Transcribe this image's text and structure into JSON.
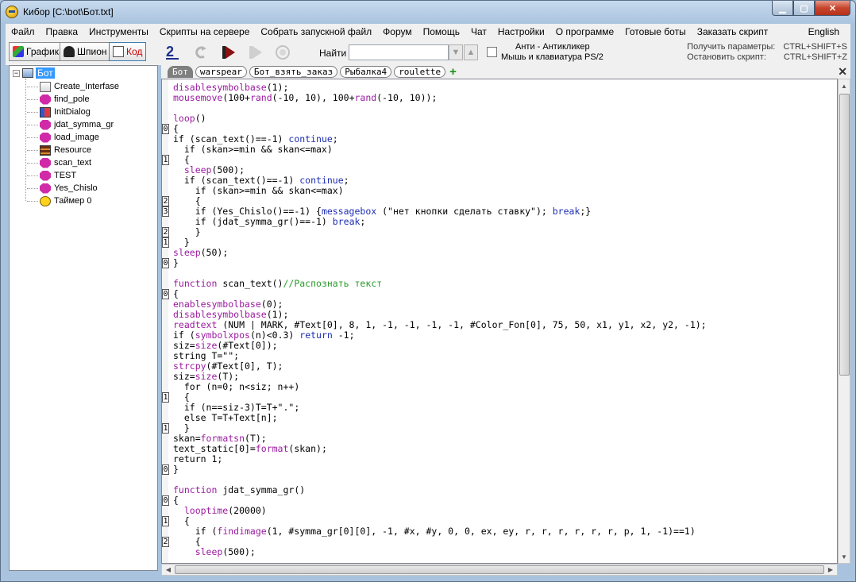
{
  "window": {
    "title": "Кибор  [C:\\bot\\Бот.txt]",
    "controls": {
      "minimize": "▁",
      "maximize": "▢",
      "close": "✕"
    }
  },
  "menu": [
    "Файл",
    "Правка",
    "Инструменты",
    "Скрипты на сервере",
    "Собрать запускной файл",
    "Форум",
    "Помощь",
    "Чат",
    "Настройки",
    "О программе",
    "Готовые боты",
    "Заказать скрипт"
  ],
  "menu_right": "English",
  "toolbar": {
    "mode_buttons": [
      "Графика",
      "Шпион",
      "Код"
    ],
    "find_label": "Найти",
    "find_value": "",
    "anti_line1": "Анти - Антикликер",
    "anti_line2": "Мышь и клавиатура PS/2",
    "hint1_label": "Получить параметры:",
    "hint1_keys": "CTRL+SHIFT+S",
    "hint2_label": "Остановить скрипт:",
    "hint2_keys": "CTRL+SHIFT+Z"
  },
  "tree": {
    "root": "Бот",
    "items": [
      {
        "label": "Create_Interfase",
        "icon": "document-icon"
      },
      {
        "label": "find_pole",
        "icon": "function-icon"
      },
      {
        "label": "InitDialog",
        "icon": "dialog-icon"
      },
      {
        "label": "jdat_symma_gr",
        "icon": "function-icon"
      },
      {
        "label": "load_image",
        "icon": "function-icon"
      },
      {
        "label": "Resource",
        "icon": "resource-icon"
      },
      {
        "label": "scan_text",
        "icon": "function-icon"
      },
      {
        "label": "TEST",
        "icon": "function-icon"
      },
      {
        "label": "Yes_Chislo",
        "icon": "function-icon"
      },
      {
        "label": "Таймер 0",
        "icon": "timer-icon"
      }
    ]
  },
  "tabs": [
    "Бот",
    "warspear",
    "Бот_взять_заказ",
    "Рыбалка4",
    "roulette"
  ],
  "tab_add": "+",
  "tab_close": "✕",
  "code_lines": [
    {
      "m": "",
      "seg": [
        [
          "f",
          "disablesymbolbase"
        ],
        [
          "d",
          "(1);"
        ]
      ]
    },
    {
      "m": "",
      "seg": [
        [
          "f",
          "mousemove"
        ],
        [
          "d",
          "(100+"
        ],
        [
          "f",
          "rand"
        ],
        [
          "d",
          "(-10, 10), 100+"
        ],
        [
          "f",
          "rand"
        ],
        [
          "d",
          "(-10, 10));"
        ]
      ]
    },
    {
      "m": "",
      "seg": [
        [
          "d",
          ""
        ]
      ]
    },
    {
      "m": "",
      "seg": [
        [
          "f",
          "loop"
        ],
        [
          "d",
          "()"
        ]
      ]
    },
    {
      "m": "0",
      "seg": [
        [
          "d",
          "{"
        ]
      ]
    },
    {
      "m": "",
      "seg": [
        [
          "d",
          "if (scan_text()==-1) "
        ],
        [
          "k",
          "continue"
        ],
        [
          "d",
          ";"
        ]
      ]
    },
    {
      "m": "",
      "seg": [
        [
          "d",
          "  if (skan>=min && skan<=max)"
        ]
      ]
    },
    {
      "m": "1",
      "seg": [
        [
          "d",
          "  {"
        ]
      ]
    },
    {
      "m": "",
      "seg": [
        [
          "f",
          "  sleep"
        ],
        [
          "d",
          "(500);"
        ]
      ]
    },
    {
      "m": "",
      "seg": [
        [
          "d",
          "  if (scan_text()==-1) "
        ],
        [
          "k",
          "continue"
        ],
        [
          "d",
          ";"
        ]
      ]
    },
    {
      "m": "",
      "seg": [
        [
          "d",
          "    if (skan>=min && skan<=max)"
        ]
      ]
    },
    {
      "m": "2",
      "seg": [
        [
          "d",
          "    {"
        ]
      ]
    },
    {
      "m": "3",
      "seg": [
        [
          "d",
          "    if (Yes_Chislo()==-1) {"
        ],
        [
          "k",
          "messagebox"
        ],
        [
          "d",
          " (\"нет кнопки сделать ставку\"); "
        ],
        [
          "k",
          "break"
        ],
        [
          "d",
          ";}"
        ]
      ]
    },
    {
      "m": "",
      "seg": [
        [
          "d",
          "    if (jdat_symma_gr()==-1) "
        ],
        [
          "k",
          "break"
        ],
        [
          "d",
          ";"
        ]
      ]
    },
    {
      "m": "2",
      "seg": [
        [
          "d",
          "    }"
        ]
      ]
    },
    {
      "m": "1",
      "seg": [
        [
          "d",
          "  }"
        ]
      ]
    },
    {
      "m": "",
      "seg": [
        [
          "f",
          "sleep"
        ],
        [
          "d",
          "(50);"
        ]
      ]
    },
    {
      "m": "0",
      "seg": [
        [
          "d",
          "}"
        ]
      ]
    },
    {
      "m": "",
      "seg": [
        [
          "d",
          ""
        ]
      ]
    },
    {
      "m": "",
      "seg": [
        [
          "f",
          "function"
        ],
        [
          "d",
          " scan_text()"
        ],
        [
          "c",
          "//Распознать текст"
        ]
      ]
    },
    {
      "m": "0",
      "seg": [
        [
          "d",
          "{"
        ]
      ]
    },
    {
      "m": "",
      "seg": [
        [
          "f",
          "enablesymbolbase"
        ],
        [
          "d",
          "(0);"
        ]
      ]
    },
    {
      "m": "",
      "seg": [
        [
          "f",
          "disablesymbolbase"
        ],
        [
          "d",
          "(1);"
        ]
      ]
    },
    {
      "m": "",
      "seg": [
        [
          "f",
          "readtext"
        ],
        [
          "d",
          " (NUM | MARK, #Text[0], 8, 1, -1, -1, -1, -1, #Color_Fon[0], 75, 50, x1, y1, x2, y2, -1);"
        ]
      ]
    },
    {
      "m": "",
      "seg": [
        [
          "d",
          "if ("
        ],
        [
          "f",
          "symbolxpos"
        ],
        [
          "d",
          "(n)<0.3) "
        ],
        [
          "k",
          "return"
        ],
        [
          "d",
          " -1;"
        ]
      ]
    },
    {
      "m": "",
      "seg": [
        [
          "d",
          "siz="
        ],
        [
          "f",
          "size"
        ],
        [
          "d",
          "(#Text[0]);"
        ]
      ]
    },
    {
      "m": "",
      "seg": [
        [
          "d",
          "string T=\"\";"
        ]
      ]
    },
    {
      "m": "",
      "seg": [
        [
          "f",
          "strcpy"
        ],
        [
          "d",
          "(#Text[0], T);"
        ]
      ]
    },
    {
      "m": "",
      "seg": [
        [
          "d",
          "siz="
        ],
        [
          "f",
          "size"
        ],
        [
          "d",
          "(T);"
        ]
      ]
    },
    {
      "m": "",
      "seg": [
        [
          "d",
          "  for (n=0; n<siz; n++)"
        ]
      ]
    },
    {
      "m": "1",
      "seg": [
        [
          "d",
          "  {"
        ]
      ]
    },
    {
      "m": "",
      "seg": [
        [
          "d",
          "  if (n==siz-3)T=T+\".\";"
        ]
      ]
    },
    {
      "m": "",
      "seg": [
        [
          "d",
          "  else T=T+Text[n];"
        ]
      ]
    },
    {
      "m": "1",
      "seg": [
        [
          "d",
          "  }"
        ]
      ]
    },
    {
      "m": "",
      "seg": [
        [
          "d",
          "skan="
        ],
        [
          "f",
          "formatsn"
        ],
        [
          "d",
          "(T);"
        ]
      ]
    },
    {
      "m": "",
      "seg": [
        [
          "d",
          "text_static[0]="
        ],
        [
          "f",
          "format"
        ],
        [
          "d",
          "(skan);"
        ]
      ]
    },
    {
      "m": "",
      "seg": [
        [
          "d",
          "return 1;"
        ]
      ]
    },
    {
      "m": "0",
      "seg": [
        [
          "d",
          "}"
        ]
      ]
    },
    {
      "m": "",
      "seg": [
        [
          "d",
          ""
        ]
      ]
    },
    {
      "m": "",
      "seg": [
        [
          "f",
          "function"
        ],
        [
          "d",
          " jdat_symma_gr()"
        ]
      ]
    },
    {
      "m": "0",
      "seg": [
        [
          "d",
          "{"
        ]
      ]
    },
    {
      "m": "",
      "seg": [
        [
          "f",
          "  looptime"
        ],
        [
          "d",
          "(20000)"
        ]
      ]
    },
    {
      "m": "1",
      "seg": [
        [
          "d",
          "  {"
        ]
      ]
    },
    {
      "m": "",
      "seg": [
        [
          "d",
          "    if ("
        ],
        [
          "f",
          "findimage"
        ],
        [
          "d",
          "(1, #symma_gr[0][0], -1, #x, #y, 0, 0, ex, ey, r, r, r, r, r, r, p, 1, -1)==1)"
        ]
      ]
    },
    {
      "m": "2",
      "seg": [
        [
          "d",
          "    {"
        ]
      ]
    },
    {
      "m": "",
      "seg": [
        [
          "f",
          "    sleep"
        ],
        [
          "d",
          "(500);"
        ]
      ]
    }
  ],
  "colors": {
    "function": "#9b1aa0",
    "keyword": "#1c2cb3",
    "comment": "#2a9a2a",
    "selection": "#3399ff"
  }
}
